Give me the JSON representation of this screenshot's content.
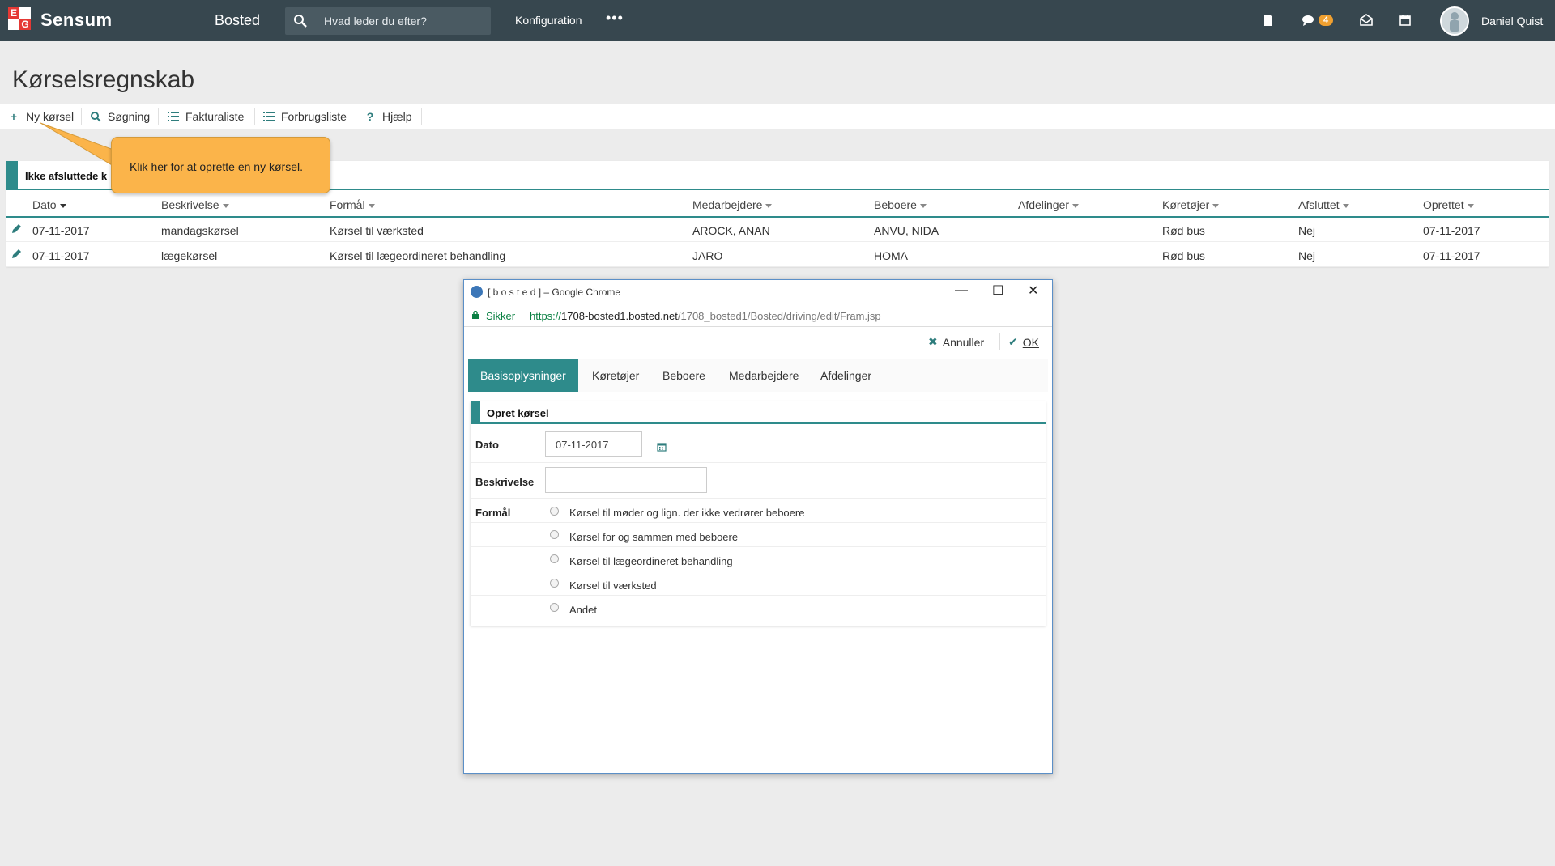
{
  "topbar": {
    "brand": "Sensum",
    "logo_letters": [
      "E",
      "G"
    ],
    "module": "Bosted",
    "search_placeholder": "Hvad leder du efter?",
    "config_label": "Konfiguration",
    "more_label": "•••",
    "notifications_count": "4",
    "user_name": "Daniel Quist",
    "icons": [
      "document-icon",
      "chat-icon",
      "mail-icon",
      "calendar-icon"
    ]
  },
  "page": {
    "title": "Kørselsregnskab"
  },
  "toolbar": {
    "items": [
      {
        "icon": "+",
        "label": "Ny kørsel"
      },
      {
        "icon": "search-icon",
        "label": "Søgning"
      },
      {
        "icon": "list-icon",
        "label": "Fakturaliste"
      },
      {
        "icon": "list-icon",
        "label": "Forbrugsliste"
      },
      {
        "icon": "?",
        "label": "Hjælp"
      }
    ]
  },
  "tooltip": {
    "text": "Klik her for at oprette en ny kørsel."
  },
  "table": {
    "title": "Ikke afsluttede k",
    "columns": [
      "Dato",
      "Beskrivelse",
      "Formål",
      "Medarbejdere",
      "Beboere",
      "Afdelinger",
      "Køretøjer",
      "Afsluttet",
      "Oprettet"
    ],
    "rows": [
      [
        "07-11-2017",
        "mandagskørsel",
        "Kørsel til værksted",
        "AROCK, ANAN",
        "ANVU, NIDA",
        "",
        "Rød bus",
        "Nej",
        "07-11-2017"
      ],
      [
        "07-11-2017",
        "lægekørsel",
        "Kørsel til lægeordineret behandling",
        "JARO",
        "HOMA",
        "",
        "Rød bus",
        "Nej",
        "07-11-2017"
      ]
    ]
  },
  "popup": {
    "window_title": "[ b o s t e d ] – Google Chrome",
    "secure_label": "Sikker",
    "url_scheme": "https://",
    "url_domain": "1708-bosted1.bosted.net",
    "url_path": "/1708_bosted1/Bosted/driving/edit/Fram.jsp",
    "cancel_label": "Annuller",
    "ok_label": "OK",
    "tabs": [
      "Basisoplysninger",
      "Køretøjer",
      "Beboere",
      "Medarbejdere",
      "Afdelinger"
    ],
    "form": {
      "title": "Opret kørsel",
      "date_label": "Dato",
      "date_value": "07-11-2017",
      "description_label": "Beskrivelse",
      "description_value": "",
      "purpose_label": "Formål",
      "purpose_options": [
        "Kørsel til møder og lign. der ikke vedrører beboere",
        "Kørsel for og sammen med beboere",
        "Kørsel til lægeordineret behandling",
        "Kørsel til værksted",
        "Andet"
      ]
    }
  },
  "colors": {
    "topbar": "#37474f",
    "accent": "#2e8b8b",
    "tooltip": "#fbb44a",
    "badge": "#f0a030"
  }
}
